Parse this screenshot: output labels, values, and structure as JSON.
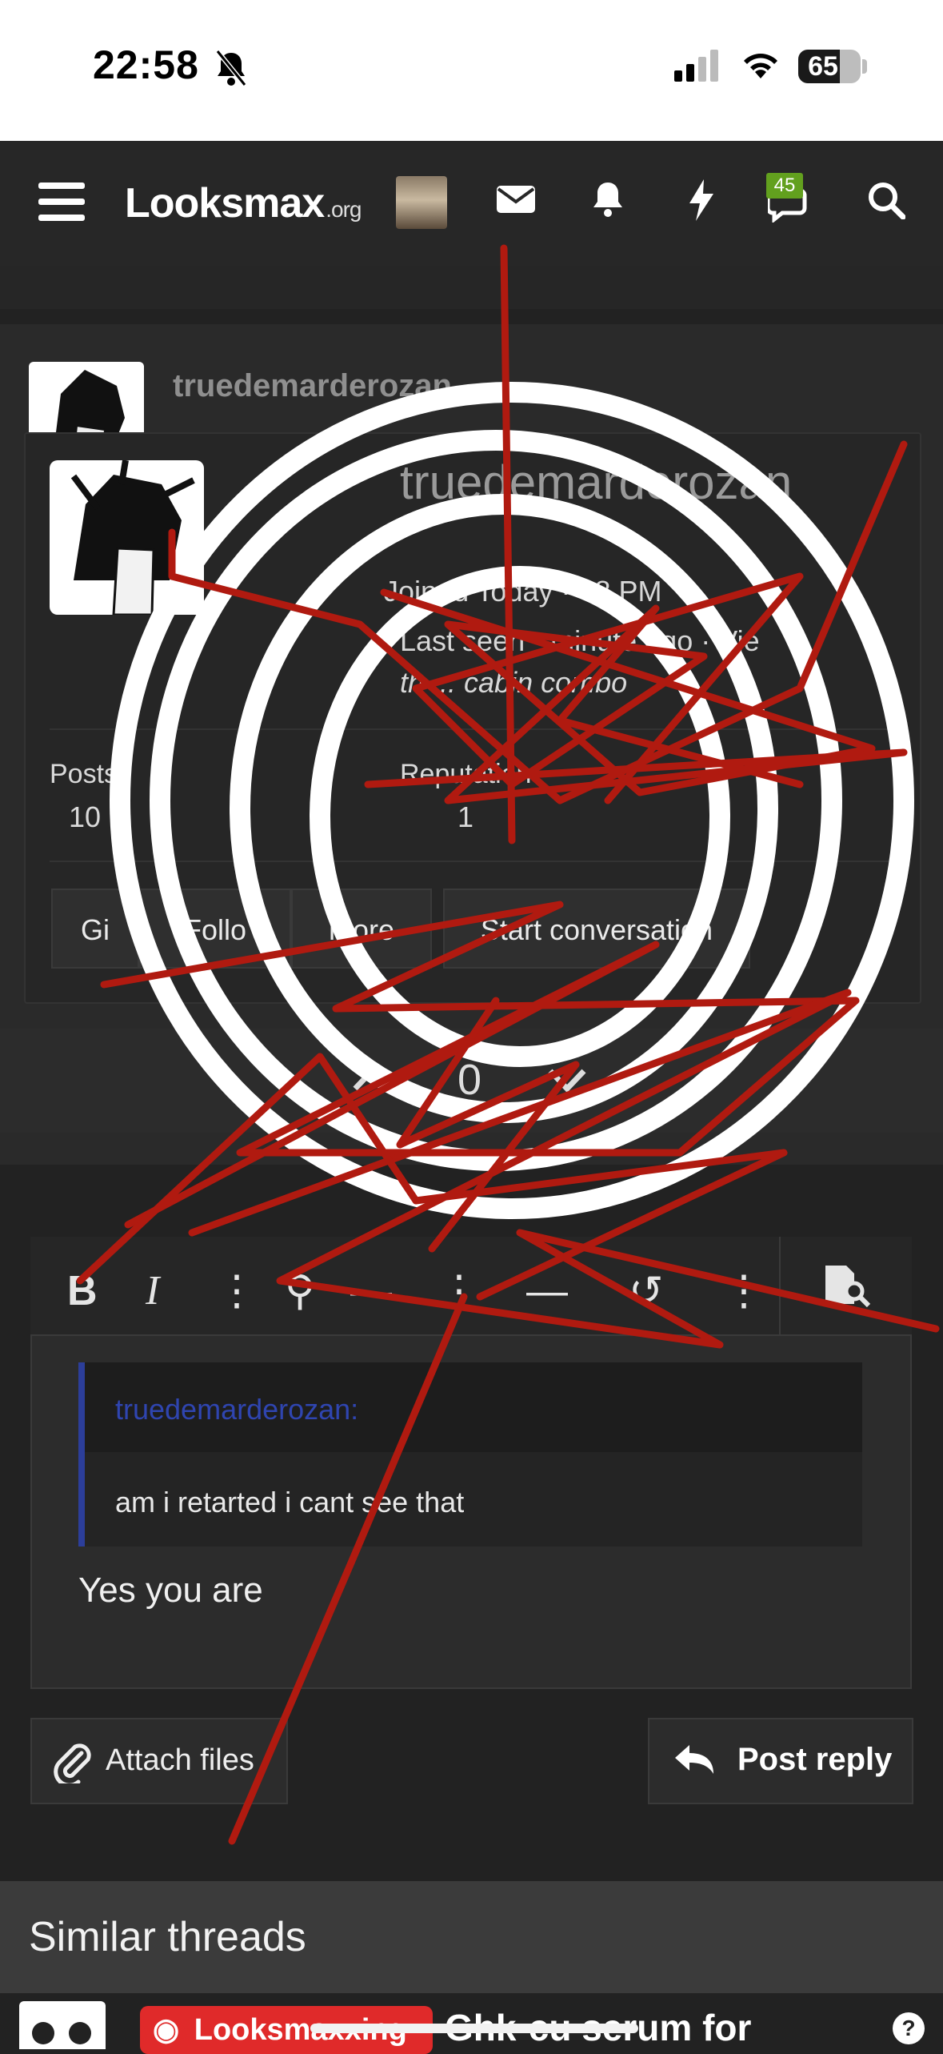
{
  "status_bar": {
    "time": "22:58",
    "battery": "65"
  },
  "nav": {
    "logo_main": "Lᴏᴏksmax",
    "logo_suffix": ".org",
    "notification_badge": "45"
  },
  "post": {
    "username": "truedemarderozan"
  },
  "member_card": {
    "username": "truedemarderozan",
    "joined": "Joined Today · 48 PM",
    "last_seen": "Last seen · minute ago · Vie",
    "viewing": "th ... cabin combo",
    "stats": [
      {
        "label": "Posts",
        "value": "10"
      },
      {
        "label": "Reputation",
        "value": "1"
      }
    ],
    "buttons": {
      "gift": "Gi",
      "follow": "Follo",
      "more": "more",
      "start_conversation": "Start conversation"
    }
  },
  "votes": {
    "count": "0"
  },
  "editor": {
    "quote_author": "truedemarderozan:",
    "quote_text": "am i retarted i cant see that",
    "reply_text": "Yes you are"
  },
  "actions": {
    "attach_files": "Attach files",
    "post_reply": "Post reply"
  },
  "similar_threads": {
    "title": "Similar threads",
    "first_thread": {
      "tag": "Looksmaxxing",
      "title": "Ghk-cu serum for"
    }
  }
}
